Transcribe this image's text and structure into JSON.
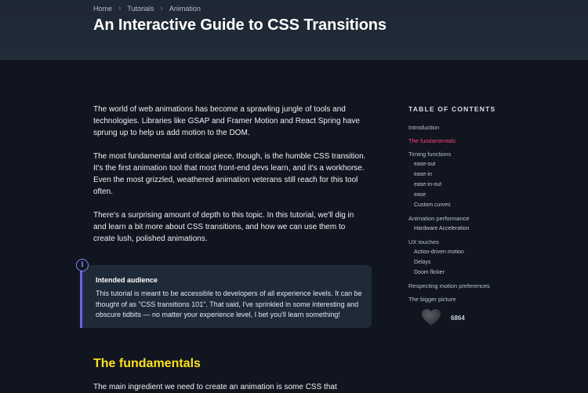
{
  "breadcrumb": [
    "Home",
    "Tutorials",
    "Animation"
  ],
  "page_title": "An Interactive Guide to CSS Transitions",
  "intro_paragraphs": [
    "The world of web animations has become a sprawling jungle of tools and technologies. Libraries like GSAP and Framer Motion and React Spring have sprung up to help us add motion to the DOM.",
    "The most fundamental and critical piece, though, is the humble CSS transition. It's the first animation tool that most front-end devs learn, and it's a workhorse. Even the most grizzled, weathered animation veterans still reach for this tool often.",
    "There's a surprising amount of depth to this topic. In this tutorial, we'll dig in and learn a bit more about CSS transitions, and how we can use them to create lush, polished animations."
  ],
  "callout": {
    "icon": "info-icon",
    "icon_glyph": "i",
    "title": "Intended audience",
    "body": "This tutorial is meant to be accessible to developers of all experience levels. It can be thought of as \"CSS transitions 101\". That said, I've sprinkled in some interesting and obscure tidbits — no matter your experience level, I bet you'll learn something!"
  },
  "section_heading": "The fundamentals",
  "section_para": "The main ingredient we need to create an animation is some CSS that",
  "toc": {
    "heading": "TABLE OF CONTENTS",
    "items": [
      {
        "label": "Introduction",
        "level": 1
      },
      {
        "label": "The fundamentals",
        "level": 1,
        "active": true
      },
      {
        "label": "Timing functions",
        "level": 1
      },
      {
        "label": "ease-out",
        "level": 2
      },
      {
        "label": "ease-in",
        "level": 2
      },
      {
        "label": "ease-in-out",
        "level": 2
      },
      {
        "label": "ease",
        "level": 2
      },
      {
        "label": "Custom curves",
        "level": 2
      },
      {
        "label": "Animation performance",
        "level": 1
      },
      {
        "label": "Hardware Acceleration",
        "level": 2
      },
      {
        "label": "UX touches",
        "level": 1
      },
      {
        "label": "Action-driven motion",
        "level": 2
      },
      {
        "label": "Delays",
        "level": 2
      },
      {
        "label": "Doom flicker",
        "level": 2
      },
      {
        "label": "Respecting motion preferences",
        "level": 1
      },
      {
        "label": "The bigger picture",
        "level": 1
      }
    ]
  },
  "like": {
    "icon": "heart-icon",
    "count": "6864"
  },
  "colors": {
    "background": "#10151f",
    "hero": "#222c39",
    "heading_accent": "#ffe01b",
    "toc_active": "#ff3f7a",
    "callout_accent": "#6a63e6"
  }
}
